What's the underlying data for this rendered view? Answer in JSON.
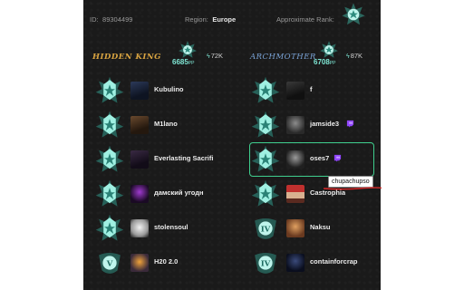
{
  "header": {
    "id_label": "ID:",
    "id_value": "89304499",
    "region_label": "Region:",
    "region_value": "Europe",
    "rank_label": "Approximate Rank:"
  },
  "teams": [
    {
      "name": "HIDDEN KING",
      "sr": "6685",
      "sr_suffix": "PP",
      "delta": "72K"
    },
    {
      "name": "ARCHMOTHER",
      "sr": "6708",
      "sr_suffix": "PP",
      "delta": "87K"
    }
  ],
  "players": [
    {
      "name": "Kubulino",
      "rank": "immortal",
      "twitch": false,
      "avatar": "dark-hooded"
    },
    {
      "name": "M1lano",
      "rank": "immortal",
      "twitch": false,
      "avatar": "brown-hair"
    },
    {
      "name": "Everlasting Sacrifi",
      "rank": "immortal",
      "twitch": false,
      "avatar": "dark-purple"
    },
    {
      "name": "дамский угодн",
      "rank": "immortal",
      "twitch": false,
      "avatar": "purple-glow"
    },
    {
      "name": "stolensoul",
      "rank": "immortal",
      "twitch": false,
      "avatar": "white-mask"
    },
    {
      "name": "H20 2.0",
      "rank": "ancient",
      "rank_numeral": "V",
      "twitch": false,
      "avatar": "orange-glow"
    },
    {
      "name": "f",
      "rank": "immortal",
      "twitch": false,
      "avatar": "dark-figure"
    },
    {
      "name": "jamside3",
      "rank": "immortal",
      "twitch": true,
      "avatar": "grey-face"
    },
    {
      "name": "oses7",
      "rank": "immortal",
      "twitch": true,
      "avatar": "grey-face-2",
      "highlight": true
    },
    {
      "name": "Castrophia",
      "rank": "immortal",
      "twitch": false,
      "avatar": "red-hat"
    },
    {
      "name": "Naksu",
      "rank": "ancient",
      "rank_numeral": "IV",
      "twitch": false,
      "avatar": "orange-face"
    },
    {
      "name": "containforcrap",
      "rank": "ancient",
      "rank_numeral": "IV",
      "twitch": false,
      "avatar": "blue-dark"
    }
  ],
  "tooltip": "chupachupso",
  "colors": {
    "panel_bg": "#1a1a1a",
    "accent": "#7fe7d5",
    "highlight": "#3fcf8e",
    "twitch": "#9146ff",
    "underline": "#d62828"
  }
}
